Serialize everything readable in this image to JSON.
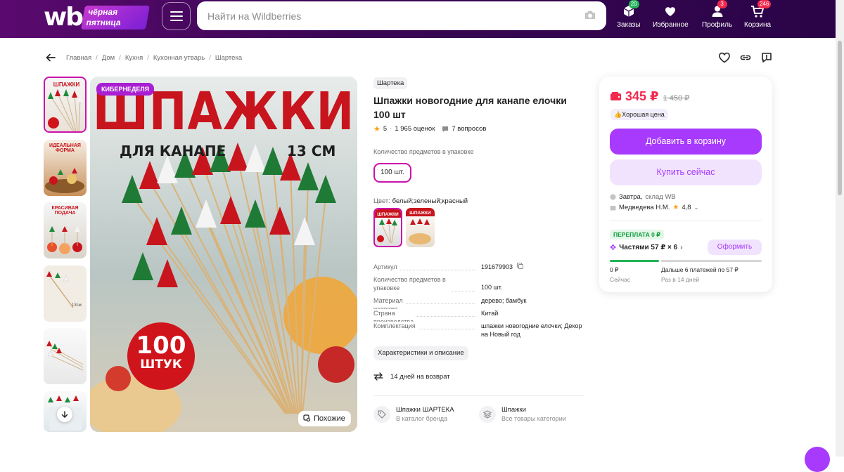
{
  "header": {
    "logo_text": "wb",
    "promo_text": "чёрная пятница",
    "search_placeholder": "Найти на Wildberries",
    "nav": [
      {
        "label": "Заказы",
        "badge": "20",
        "badge_color": "#22b357"
      },
      {
        "label": "Избранное",
        "badge": "",
        "badge_color": ""
      },
      {
        "label": "Профиль",
        "badge": "3",
        "badge_color": "#f2294d"
      },
      {
        "label": "Корзина",
        "badge": "246",
        "badge_color": "#f2294d"
      }
    ]
  },
  "breadcrumb": [
    "Главная",
    "Дом",
    "Кухня",
    "Кухонная утварь",
    "Шартека"
  ],
  "gallery": {
    "badge": "КИБЕРНЕДЕЛЯ",
    "image_title": "ШПАЖКИ",
    "image_sub_left": "ДЛЯ КАНАПЕ",
    "image_sub_right": "13 СМ",
    "image_count": "100",
    "image_count_unit": "ШТУК",
    "similar_label": "Похожие",
    "thumbs": [
      {
        "caption": "ШПАЖКИ"
      },
      {
        "caption": "ИДЕАЛЬНАЯ ФОРМА"
      },
      {
        "caption": "КРАСИВАЯ ПОДАЧА"
      },
      {
        "caption": "13см"
      },
      {
        "caption": ""
      },
      {
        "caption": ""
      }
    ]
  },
  "product": {
    "brand": "Шартека",
    "title": "Шпажки новогодние для канапе елочки 100 шт",
    "rating": "5",
    "reviews": "1 965 оценок",
    "questions": "7 вопросов",
    "qty_label": "Количество предметов в упаковке",
    "qty_value": "100 шт.",
    "color_prefix": "Цвет:",
    "color_value": "белый;зеленый;красный",
    "color_thumbs": [
      "ШПАЖКИ",
      "ШПАЖКИ"
    ],
    "specs": [
      {
        "key": "Артикул",
        "value": "191679903"
      },
      {
        "key": "Количество предметов в упаковке",
        "value": "100 шт."
      },
      {
        "key": "Материал изделия",
        "value": "дерево; бамбук"
      },
      {
        "key": "Страна производства",
        "value": "Китай"
      },
      {
        "key": "Комплектация",
        "value": "шпажки новогодние елочки; Декор на Новый год"
      }
    ],
    "characteristics_button": "Характеристики и описание",
    "return_text": "14 дней на возврат",
    "brand_links": [
      {
        "title": "Шпажки ШАРТЕКА",
        "subtitle": "В каталог бренда"
      },
      {
        "title": "Шпажки",
        "subtitle": "Все товары категории"
      }
    ]
  },
  "card": {
    "price": "345 ₽",
    "old_price": "1 450 ₽",
    "good_price": "Хорошая цена",
    "add_to_cart": "Добавить в корзину",
    "buy_now": "Купить сейчас",
    "delivery_when": "Завтра,",
    "delivery_where": "склад WB",
    "seller": "Медведева Н.М.",
    "seller_rating": "4,8",
    "overpay": "ПЕРЕПЛАТА 0 ₽",
    "installments": "Частями 57 ₽ × 6",
    "issue_button": "Оформить",
    "pay_now_amount": "0 ₽",
    "pay_now_label": "Сейчас",
    "pay_later_amount": "Дальше 6 платежей по 57 ₽",
    "pay_later_label": "Раз в 14 дней"
  },
  "colors": {
    "accent": "#a73afd",
    "wb_pink": "#cb11ab",
    "price_red": "#f2294d",
    "green": "#22b357",
    "header_bg": "#3a0654"
  }
}
